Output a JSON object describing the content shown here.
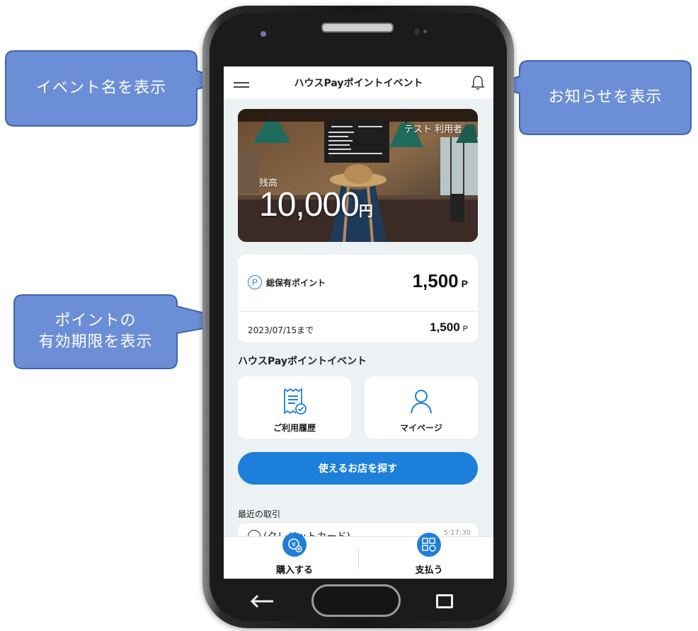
{
  "callouts": {
    "event_name": "イベント名を表示",
    "notifications": "お知らせを表示",
    "points_expiry_line1": "ポイントの",
    "points_expiry_line2": "有効期限を表示"
  },
  "app": {
    "title": "ハウスPayポイントイベント",
    "user_name": "テスト 利用者",
    "balance_label": "残高",
    "balance_amount": "10,000",
    "balance_unit": "円"
  },
  "points": {
    "icon_letter": "P",
    "label": "総保有ポイント",
    "total": "1,500",
    "unit": "P",
    "expiry_date": "2023/07/15まで",
    "expiry_amount": "1,500",
    "expiry_unit": "P"
  },
  "event": {
    "heading": "ハウスPayポイントイベント",
    "history_label": "ご利用履歴",
    "mypage_label": "マイページ",
    "find_store_label": "使えるお店を探す"
  },
  "recent": {
    "heading": "最近の取引",
    "row_text": "(クレジットカード)",
    "row_time": "5:17:30"
  },
  "bottom_bar": {
    "purchase_label": "購入する",
    "pay_label": "支払う"
  },
  "colors": {
    "accent": "#1f7fd8",
    "callout_fill": "#6b8ed6",
    "callout_stroke": "#3f64b0"
  }
}
